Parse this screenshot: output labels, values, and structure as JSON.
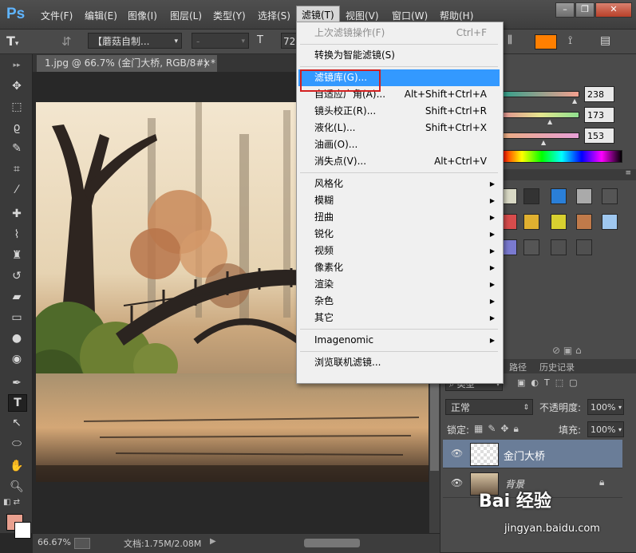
{
  "app": {
    "logo": "Ps"
  },
  "menubar": {
    "items": [
      "文件(F)",
      "编辑(E)",
      "图像(I)",
      "图层(L)",
      "类型(Y)",
      "选择(S)",
      "滤镜(T)",
      "视图(V)",
      "窗口(W)",
      "帮助(H)"
    ],
    "active_index": 6
  },
  "window_controls": {
    "minimize": "–",
    "restore": "❐",
    "close": "✕"
  },
  "options_bar": {
    "tool_icon": "T",
    "font_family": "【蘑菇自制...",
    "font_style": "-",
    "font_size": "72"
  },
  "document_tab": {
    "title": "1.jpg @ 66.7% (金门大桥, RGB/8#) *",
    "close": "×"
  },
  "status": {
    "zoom": "66.67%",
    "doc_info": "文档:1.75M/2.08M"
  },
  "color_sliders": {
    "values": [
      "238",
      "173",
      "153"
    ]
  },
  "layers_panel": {
    "tabs": [
      "路径",
      "历史记录"
    ],
    "filter_label": "类型",
    "blend_mode": "正常",
    "opacity_label": "不透明度:",
    "opacity_value": "100%",
    "lock_label": "锁定:",
    "fill_label": "填充:",
    "fill_value": "100%",
    "layers": [
      {
        "name": "金门大桥",
        "selected": true
      },
      {
        "name": "背景",
        "locked": true
      }
    ]
  },
  "filter_menu": {
    "items": [
      {
        "label": "上次滤镜操作(F)",
        "shortcut": "Ctrl+F",
        "disabled": true
      },
      {
        "sep": true
      },
      {
        "label": "转换为智能滤镜(S)"
      },
      {
        "sep": true
      },
      {
        "label": "滤镜库(G)...",
        "highlighted": true
      },
      {
        "label": "自适应广角(A)...",
        "shortcut": "Alt+Shift+Ctrl+A"
      },
      {
        "label": "镜头校正(R)...",
        "shortcut": "Shift+Ctrl+R"
      },
      {
        "label": "液化(L)...",
        "shortcut": "Shift+Ctrl+X"
      },
      {
        "label": "油画(O)..."
      },
      {
        "label": "消失点(V)...",
        "shortcut": "Alt+Ctrl+V"
      },
      {
        "sep": true
      },
      {
        "label": "风格化",
        "submenu": true
      },
      {
        "label": "模糊",
        "submenu": true
      },
      {
        "label": "扭曲",
        "submenu": true
      },
      {
        "label": "锐化",
        "submenu": true
      },
      {
        "label": "视频",
        "submenu": true
      },
      {
        "label": "像素化",
        "submenu": true
      },
      {
        "label": "渲染",
        "submenu": true
      },
      {
        "label": "杂色",
        "submenu": true
      },
      {
        "label": "其它",
        "submenu": true
      },
      {
        "sep": true
      },
      {
        "label": "Imagenomic",
        "submenu": true
      },
      {
        "sep": true
      },
      {
        "label": "浏览联机滤镜..."
      }
    ]
  },
  "watermark": {
    "brand": "Bai 经验",
    "url": "jingyan.baidu.com"
  },
  "colors": {
    "highlight": "#3399ff",
    "redbox": "#d32020",
    "accent_swatch": "#ff7f00"
  }
}
